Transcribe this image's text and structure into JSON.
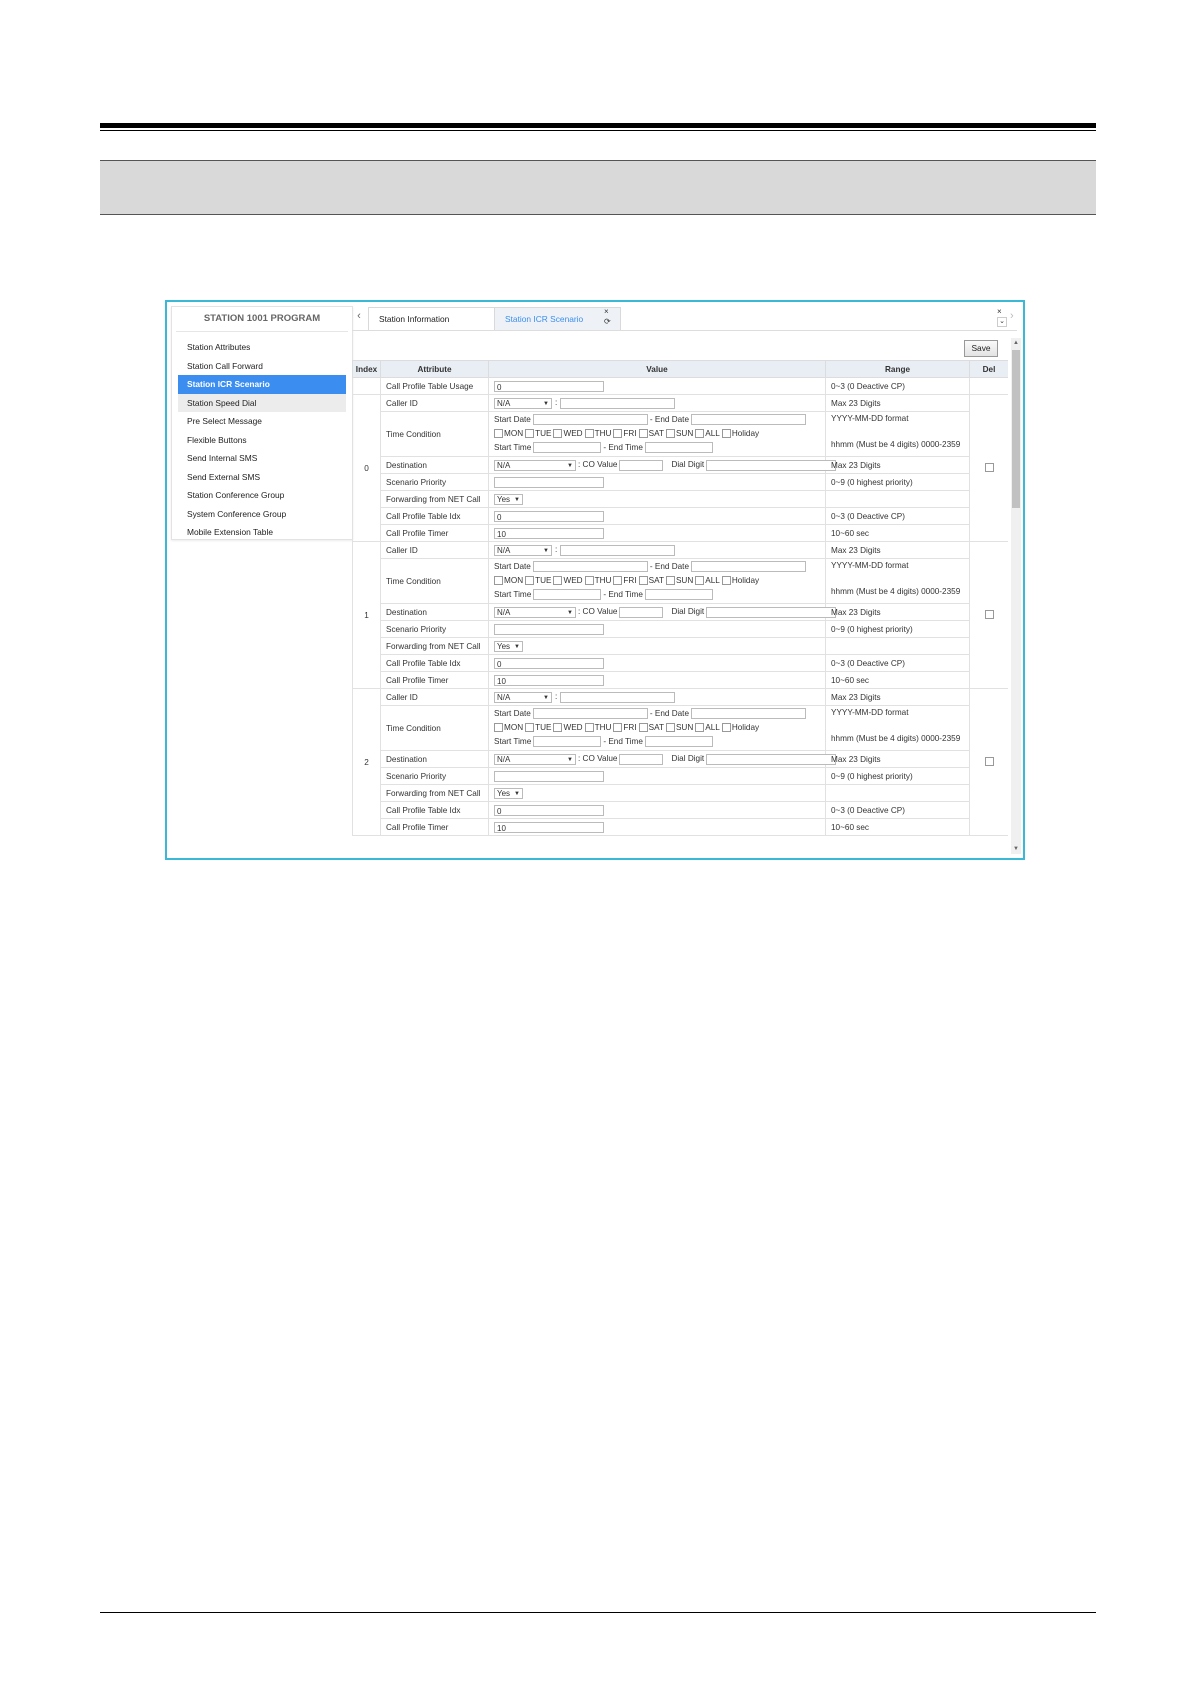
{
  "sidebar": {
    "title": "STATION 1001 PROGRAM",
    "items": [
      {
        "label": "Station Attributes"
      },
      {
        "label": "Station Call Forward"
      },
      {
        "label": "Station ICR Scenario"
      },
      {
        "label": "Station Speed Dial"
      },
      {
        "label": "Pre Select Message"
      },
      {
        "label": "Flexible Buttons"
      },
      {
        "label": "Send Internal SMS"
      },
      {
        "label": "Send External SMS"
      },
      {
        "label": "Station Conference Group"
      },
      {
        "label": "System Conference Group"
      },
      {
        "label": "Mobile Extension Table"
      }
    ]
  },
  "tabs": {
    "prev": "‹",
    "next": "›",
    "items": [
      {
        "label": "Station Information"
      },
      {
        "label": "Station ICR Scenario"
      }
    ],
    "close": "×",
    "refresh": "⟳",
    "expand": "⌄"
  },
  "toolbar": {
    "save_label": "Save"
  },
  "table": {
    "headers": {
      "index": "Index",
      "attribute": "Attribute",
      "value": "Value",
      "range": "Range",
      "del": "Del"
    },
    "usage": {
      "label": "Call Profile Table Usage",
      "value": "0",
      "range": "0~3 (0 Deactive CP)"
    },
    "labels": {
      "caller_id": "Caller ID",
      "time_condition": "Time Condition",
      "destination": "Destination",
      "scenario_priority": "Scenario Priority",
      "forwarding": "Forwarding from NET Call",
      "cp_idx": "Call Profile Table Idx",
      "cp_timer": "Call Profile Timer",
      "start_date": "Start Date",
      "end_date": "- End Date",
      "start_time": "Start Time",
      "end_time": "- End Time",
      "co_value": ": CO Value",
      "dial_digit": "Dial Digit",
      "colon": ":"
    },
    "days": [
      "MON",
      "TUE",
      "WED",
      "THU",
      "FRI",
      "SAT",
      "SUN",
      "ALL",
      "Holiday"
    ],
    "ranges": {
      "caller_id": "Max 23 Digits",
      "date_format": "YYYY-MM-DD format",
      "time_format": "hhmm (Must be 4 digits) 0000-2359",
      "destination": "Max 23 Digits",
      "priority": "0~9 (0 highest priority)",
      "cp_idx": "0~3 (0 Deactive CP)",
      "cp_timer": "10~60 sec"
    },
    "defaults": {
      "caller_id_select": "N/A",
      "destination_select": "N/A",
      "forwarding_select": "Yes",
      "cp_idx": "0",
      "cp_timer": "10"
    },
    "scenarios": [
      {
        "index": "0"
      },
      {
        "index": "1"
      },
      {
        "index": "2"
      }
    ]
  }
}
